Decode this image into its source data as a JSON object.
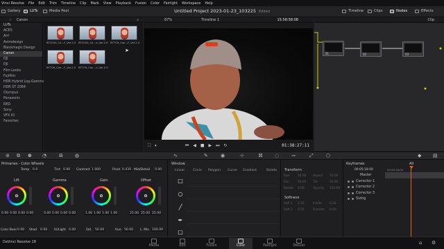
{
  "menubar": {
    "app": "Vinci Resolve",
    "items": [
      "File",
      "Edit",
      "Trim",
      "Timeline",
      "Clip",
      "Mark",
      "View",
      "Playback",
      "Fusion",
      "Color",
      "Fairlight",
      "Workspace",
      "Help"
    ]
  },
  "toolbar": {
    "left": [
      "Gallery",
      "LUTs",
      "Media Pool"
    ],
    "title": "Untitled Project 2023-01-23_103225",
    "status": "Edited",
    "right": [
      "Timeline",
      "Clips",
      "Nodes",
      "Effects"
    ]
  },
  "subbar": {
    "folder": "Canon",
    "zoom": "67%",
    "timeline": "Timeline 1",
    "timecode": "15:58:58:08",
    "clip_label": "Clip"
  },
  "lut_sidebar": {
    "items": [
      "LUTs",
      "ACES",
      "Arri",
      "Astrodesign",
      "Blackmagic Design",
      "Canon",
      "DJI",
      "DJI",
      "Film Looks",
      "Fujifilm",
      "HDR Hybrid Log-Gamma",
      "HDR ST 2084",
      "Olympus",
      "Panasonic",
      "RED",
      "Sony",
      "VFX IO",
      "Favorites"
    ],
    "selected_index": 5
  },
  "luts": [
    {
      "label": "BT2020_Ca...F_Ver.2.0"
    },
    {
      "label": "BT2020_Ca...V_Ver.2.0"
    },
    {
      "label": "BT709_Can...F_Ver.2.0"
    },
    {
      "label": "BT709_Can...F_Ver.2.0"
    },
    {
      "label": "BT709_Can...V_Ver.2.0"
    }
  ],
  "viewer": {
    "timecode": "01:38:27:11"
  },
  "nodes": [
    {
      "num": "01"
    },
    {
      "num": "02"
    },
    {
      "num": "03"
    }
  ],
  "color_wheels": {
    "title": "Primaries - Color Wheels",
    "top_params": [
      {
        "label": "Temp",
        "value": "0.0"
      },
      {
        "label": "Tint",
        "value": "0.00"
      },
      {
        "label": "Contrast",
        "value": "1.000"
      },
      {
        "label": "Pivot",
        "value": "0.435"
      },
      {
        "label": "Mid/Detail",
        "value": "0.00"
      }
    ],
    "wheels": [
      {
        "name": "Lift",
        "values": [
          "0.00",
          "0.00",
          "0.00",
          "0.00"
        ]
      },
      {
        "name": "Gamma",
        "values": [
          "0.00",
          "0.00",
          "0.00",
          "0.00"
        ]
      },
      {
        "name": "Gain",
        "values": [
          "1.00",
          "1.00",
          "1.00",
          "1.00"
        ]
      },
      {
        "name": "Offset",
        "values": [
          "25.00",
          "25.00",
          "25.00"
        ]
      }
    ],
    "bottom_params": [
      {
        "label": "Color Boost",
        "value": "0.00"
      },
      {
        "label": "Shad",
        "value": "0.00"
      },
      {
        "label": "Hi/Light",
        "value": "0.00"
      },
      {
        "label": "Sat",
        "value": "50.00"
      },
      {
        "label": "Hue",
        "value": "50.00"
      },
      {
        "label": "L. Mix",
        "value": "100.00"
      }
    ]
  },
  "window": {
    "title": "Window",
    "shapes": [
      "Linear",
      "Circle",
      "Polygon",
      "Curve",
      "Gradient"
    ],
    "delete": "Delete"
  },
  "transform": {
    "title": "Transform",
    "rows": [
      [
        "Size",
        "50.00",
        "Aspect",
        "50.00"
      ],
      [
        "Pan",
        "50.00",
        "Tilt",
        "50.00"
      ],
      [
        "Rotate",
        "0.00",
        "Opacity",
        "100.00"
      ]
    ],
    "softness_title": "Softness",
    "softness_rows": [
      [
        "Soft 1",
        "2.50",
        "Inside",
        "0.00"
      ],
      [
        "Soft 2",
        "0.50",
        "Outside",
        "0.00"
      ]
    ]
  },
  "keyframes": {
    "title": "Keyframes",
    "filter": "All",
    "timecodes": [
      "00:05:18:00",
      "00:05:18:00"
    ],
    "tracks": [
      "Master",
      "Corrector 1",
      "Corrector 2",
      "Corrector 3",
      "Sizing"
    ]
  },
  "statusbar": {
    "app": "DaVinci Resolve 18"
  },
  "pages": [
    "Media",
    "Edit",
    "Fusion",
    "Color",
    "Fairlight",
    "Deliver"
  ],
  "active_page": "Color",
  "colors": {
    "accent_orange": "#e0661f",
    "selected": "#363639",
    "node_line": "#d8d000"
  }
}
